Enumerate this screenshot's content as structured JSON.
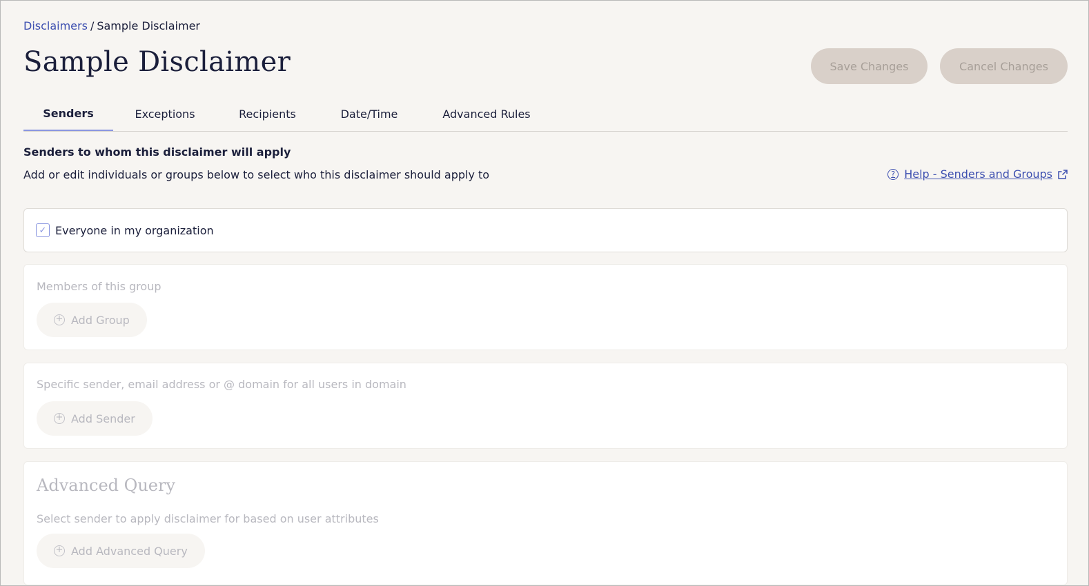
{
  "breadcrumb": {
    "parent": "Disclaimers",
    "separator": "/",
    "current": "Sample Disclaimer"
  },
  "page": {
    "title": "Sample Disclaimer"
  },
  "actions": {
    "save_label": "Save Changes",
    "cancel_label": "Cancel Changes"
  },
  "tabs": [
    {
      "label": "Senders",
      "active": true
    },
    {
      "label": "Exceptions",
      "active": false
    },
    {
      "label": "Recipients",
      "active": false
    },
    {
      "label": "Date/Time",
      "active": false
    },
    {
      "label": "Advanced Rules",
      "active": false
    }
  ],
  "senders_section": {
    "heading": "Senders to whom this disclaimer will apply",
    "description": "Add or edit individuals or groups below to select who this disclaimer should apply to",
    "help_link": "Help - Senders and Groups"
  },
  "everyone": {
    "label": "Everyone in my organization",
    "checked": true
  },
  "group_card": {
    "label": "Members of this group",
    "button": "Add Group"
  },
  "sender_card": {
    "label": "Specific sender, email address or @ domain for all users in domain",
    "button": "Add Sender"
  },
  "advanced_query": {
    "heading": "Advanced Query",
    "label": "Select sender to apply disclaimer for based on user attributes",
    "button": "Add Advanced Query"
  },
  "colors": {
    "link": "#3d4fb0",
    "active_tab_underline": "#8a96e0",
    "button_disabled_bg": "#d9d0c9",
    "disabled_text": "#b8b8bf"
  },
  "icons": {
    "help": "question-circle-icon",
    "external": "external-link-icon",
    "check": "checkmark-icon",
    "add": "plus-circle-icon"
  }
}
